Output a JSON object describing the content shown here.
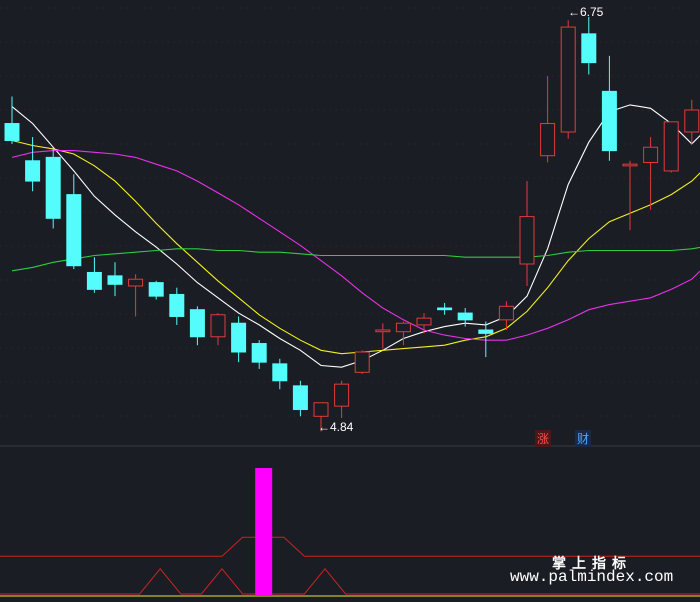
{
  "chart_data": {
    "type": "candlestick",
    "price": {
      "candles": [
        {
          "o": 6.12,
          "h": 6.28,
          "l": 6.0,
          "c": 6.02
        },
        {
          "o": 5.9,
          "h": 6.04,
          "l": 5.72,
          "c": 5.78
        },
        {
          "o": 5.92,
          "h": 5.98,
          "l": 5.5,
          "c": 5.56
        },
        {
          "o": 5.7,
          "h": 5.82,
          "l": 5.26,
          "c": 5.28
        },
        {
          "o": 5.24,
          "h": 5.33,
          "l": 5.12,
          "c": 5.14
        },
        {
          "o": 5.22,
          "h": 5.3,
          "l": 5.1,
          "c": 5.17
        },
        {
          "o": 5.16,
          "h": 5.23,
          "l": 4.98,
          "c": 5.2
        },
        {
          "o": 5.18,
          "h": 5.19,
          "l": 5.08,
          "c": 5.1
        },
        {
          "o": 5.11,
          "h": 5.15,
          "l": 4.93,
          "c": 4.98
        },
        {
          "o": 5.02,
          "h": 5.04,
          "l": 4.81,
          "c": 4.86
        },
        {
          "o": 4.86,
          "h": 5.0,
          "l": 4.81,
          "c": 4.99
        },
        {
          "o": 4.94,
          "h": 4.98,
          "l": 4.71,
          "c": 4.77
        },
        {
          "o": 4.82,
          "h": 4.84,
          "l": 4.67,
          "c": 4.71
        },
        {
          "o": 4.7,
          "h": 4.73,
          "l": 4.55,
          "c": 4.6
        },
        {
          "o": 4.57,
          "h": 4.6,
          "l": 4.39,
          "c": 4.43
        },
        {
          "o": 4.39,
          "h": 4.47,
          "l": 4.3,
          "c": 4.47
        },
        {
          "o": 4.45,
          "h": 4.6,
          "l": 4.38,
          "c": 4.58
        },
        {
          "o": 4.65,
          "h": 4.78,
          "l": 4.64,
          "c": 4.77
        },
        {
          "o": 4.89,
          "h": 4.94,
          "l": 4.79,
          "c": 4.9
        },
        {
          "o": 4.89,
          "h": 4.95,
          "l": 4.81,
          "c": 4.94
        },
        {
          "o": 4.93,
          "h": 5.0,
          "l": 4.88,
          "c": 4.97
        },
        {
          "o": 5.03,
          "h": 5.06,
          "l": 4.99,
          "c": 5.02
        },
        {
          "o": 5.0,
          "h": 5.03,
          "l": 4.92,
          "c": 4.96
        },
        {
          "o": 4.9,
          "h": 4.95,
          "l": 4.74,
          "c": 4.88
        },
        {
          "o": 4.96,
          "h": 5.07,
          "l": 4.9,
          "c": 5.04
        },
        {
          "o": 5.29,
          "h": 5.78,
          "l": 5.16,
          "c": 5.57
        },
        {
          "o": 5.93,
          "h": 6.4,
          "l": 5.89,
          "c": 6.12
        },
        {
          "o": 6.07,
          "h": 6.73,
          "l": 6.03,
          "c": 6.69
        },
        {
          "o": 6.65,
          "h": 6.75,
          "l": 6.41,
          "c": 6.48
        },
        {
          "o": 6.31,
          "h": 6.52,
          "l": 5.9,
          "c": 5.96
        },
        {
          "o": 5.87,
          "h": 5.9,
          "l": 5.49,
          "c": 5.88
        },
        {
          "o": 5.89,
          "h": 6.04,
          "l": 5.61,
          "c": 5.98
        },
        {
          "o": 5.84,
          "h": 6.13,
          "l": 5.83,
          "c": 6.13
        },
        {
          "o": 6.07,
          "h": 6.26,
          "l": 6.0,
          "c": 6.2
        },
        {
          "o": 6.16,
          "h": 6.64,
          "l": 6.04,
          "c": 6.64
        }
      ],
      "ma": [
        {
          "color": "#ffffff",
          "values": [
            6.22,
            6.12,
            5.98,
            5.84,
            5.69,
            5.58,
            5.48,
            5.39,
            5.29,
            5.18,
            5.09,
            5.0,
            4.93,
            4.85,
            4.78,
            4.69,
            4.68,
            4.72,
            4.78,
            4.85,
            4.89,
            4.92,
            4.94,
            4.93,
            4.98,
            5.1,
            5.38,
            5.76,
            6.01,
            6.19,
            6.23,
            6.21,
            6.12,
            6.0,
            6.12
          ]
        },
        {
          "color": "#f2f21e",
          "values": [
            6.02,
            5.99,
            5.97,
            5.94,
            5.87,
            5.78,
            5.66,
            5.53,
            5.41,
            5.3,
            5.19,
            5.09,
            4.99,
            4.91,
            4.84,
            4.78,
            4.76,
            4.77,
            4.78,
            4.79,
            4.8,
            4.81,
            4.84,
            4.86,
            4.91,
            5.01,
            5.15,
            5.31,
            5.44,
            5.54,
            5.59,
            5.64,
            5.7,
            5.78,
            5.9
          ]
        },
        {
          "color": "#e633e6",
          "values": [
            5.92,
            5.95,
            5.96,
            5.96,
            5.95,
            5.94,
            5.92,
            5.88,
            5.84,
            5.78,
            5.71,
            5.64,
            5.56,
            5.48,
            5.4,
            5.31,
            5.22,
            5.12,
            5.03,
            4.96,
            4.9,
            4.87,
            4.85,
            4.84,
            4.84,
            4.87,
            4.91,
            4.96,
            5.02,
            5.05,
            5.07,
            5.09,
            5.14,
            5.2,
            5.32
          ]
        },
        {
          "color": "#2ecc40",
          "values": [
            5.25,
            5.27,
            5.3,
            5.32,
            5.34,
            5.35,
            5.36,
            5.37,
            5.38,
            5.38,
            5.37,
            5.37,
            5.36,
            5.36,
            5.35,
            5.34,
            5.34,
            5.34,
            5.34,
            5.34,
            5.34,
            5.34,
            5.33,
            5.33,
            5.33,
            5.33,
            5.34,
            5.36,
            5.37,
            5.37,
            5.37,
            5.37,
            5.37,
            5.38,
            5.4
          ]
        }
      ],
      "max_label": "6.75",
      "min_label": "4.84",
      "max_arrow": "←",
      "min_arrow": "←",
      "ylim": [
        4.25,
        6.85
      ],
      "grid": true
    },
    "event_tags": [
      {
        "text": "涨",
        "color": "#ff4d4d",
        "background": "#4a1818"
      },
      {
        "text": "财",
        "color": "#4da6ff",
        "background": "#182a4a"
      }
    ],
    "indicator": {
      "spike": {
        "index": 12,
        "value": 1.0,
        "color": "#ff00ff"
      },
      "upper_line": {
        "color": "#cc2222",
        "values": [
          0.3,
          0.3,
          0.3,
          0.3,
          0.3,
          0.3,
          0.3,
          0.3,
          0.3,
          0.3,
          0.3,
          0.45,
          0.45,
          0.45,
          0.3,
          0.3,
          0.3,
          0.3,
          0.3,
          0.3,
          0.3,
          0.3,
          0.3,
          0.3,
          0.3,
          0.3,
          0.3,
          0.3,
          0.3,
          0.3,
          0.3,
          0.3,
          0.3,
          0.3,
          0.3
        ]
      },
      "lower_line": {
        "color": "#cc2222",
        "values": [
          0.0,
          0.0,
          0.0,
          0.0,
          0.0,
          0.0,
          0.0,
          0.2,
          0.0,
          0.0,
          0.2,
          0.0,
          0.0,
          0.0,
          0.0,
          0.2,
          0.0,
          0.0,
          0.0,
          0.0,
          0.0,
          0.0,
          0.0,
          0.0,
          0.0,
          0.0,
          0.0,
          0.0,
          0.0,
          0.0,
          0.0,
          0.0,
          0.0,
          0.0,
          0.0
        ]
      },
      "baseline_color": "#e6e633"
    }
  },
  "colors": {
    "background": "#1b1d24",
    "grid": "#a03030",
    "up": "#e03b3b",
    "down": "#54fcfc",
    "separator": "#3a3a44"
  },
  "watermark": {
    "line1": "掌上指标",
    "line2": "www.palmindex.com"
  }
}
